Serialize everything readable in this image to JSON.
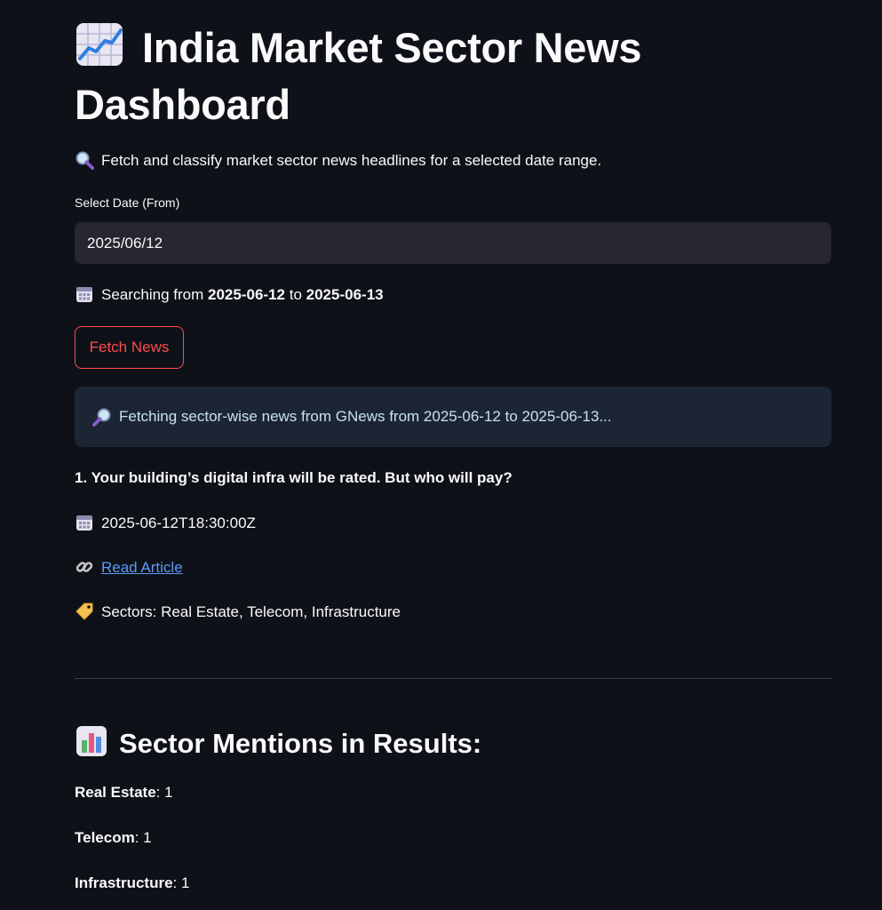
{
  "app": {
    "title": "India Market Sector News Dashboard",
    "subtitle": "Fetch and classify market sector news headlines for a selected date range."
  },
  "date_input": {
    "label": "Select Date (From)",
    "value": "2025/06/12"
  },
  "search_range": {
    "prefix": "Searching from",
    "from": "2025-06-12",
    "connector": "to",
    "to": "2025-06-13"
  },
  "fetch_button": {
    "label": "Fetch News"
  },
  "info": {
    "message": "Fetching sector-wise news from GNews from 2025-06-12 to 2025-06-13..."
  },
  "articles": [
    {
      "headline": "1. Your building’s digital infra will be rated. But who will pay?",
      "published": "2025-06-12T18:30:00Z",
      "link_text": "Read Article",
      "sectors": "Sectors: Real Estate, Telecom, Infrastructure"
    }
  ],
  "mentions": {
    "heading": "Sector Mentions in Results:",
    "items": [
      {
        "sector": "Real Estate",
        "count": ": 1"
      },
      {
        "sector": "Telecom",
        "count": ": 1"
      },
      {
        "sector": "Infrastructure",
        "count": ": 1"
      }
    ]
  },
  "icons": {
    "title": "chart-increasing-icon",
    "subtitle": "magnifying-glass-icon",
    "calendar": "calendar-icon",
    "info": "magnifying-glass-right-icon",
    "link": "link-icon",
    "tag": "label-tag-icon",
    "mentions": "bar-chart-icon"
  },
  "colors": {
    "background": "#0e1117",
    "accent": "#ff4b4b",
    "link": "#5b9cf5",
    "info_bg": "#1c2534",
    "input_bg": "#262730"
  }
}
